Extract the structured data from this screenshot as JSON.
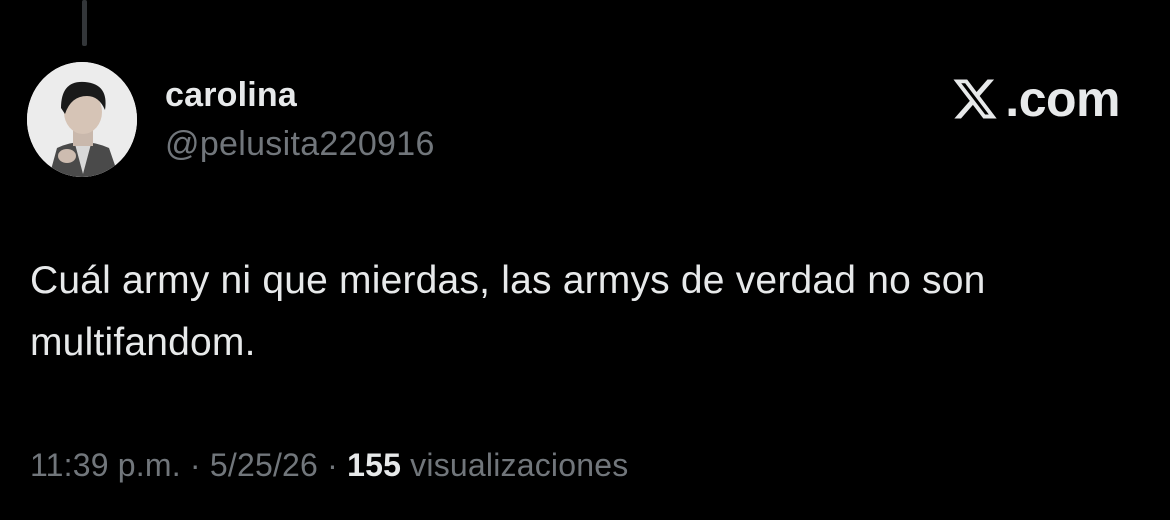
{
  "tweet": {
    "author": {
      "display_name": "carolina",
      "handle": "@pelusita220916",
      "avatar": "profile-photo"
    },
    "brand": {
      "icon": "x-logo-icon",
      "domain": ".com"
    },
    "text": "Cuál army ni que mierdas, las armys de verdad no son multifandom.",
    "meta": {
      "time": "11:39 p.m.",
      "separator": " · ",
      "date": "5/25/26",
      "views_count": "155",
      "views_label": " visualizaciones"
    }
  },
  "colors": {
    "background": "#000000",
    "primary_text": "#e7e9ea",
    "secondary_text": "#71767b",
    "thread_line": "#333639"
  }
}
